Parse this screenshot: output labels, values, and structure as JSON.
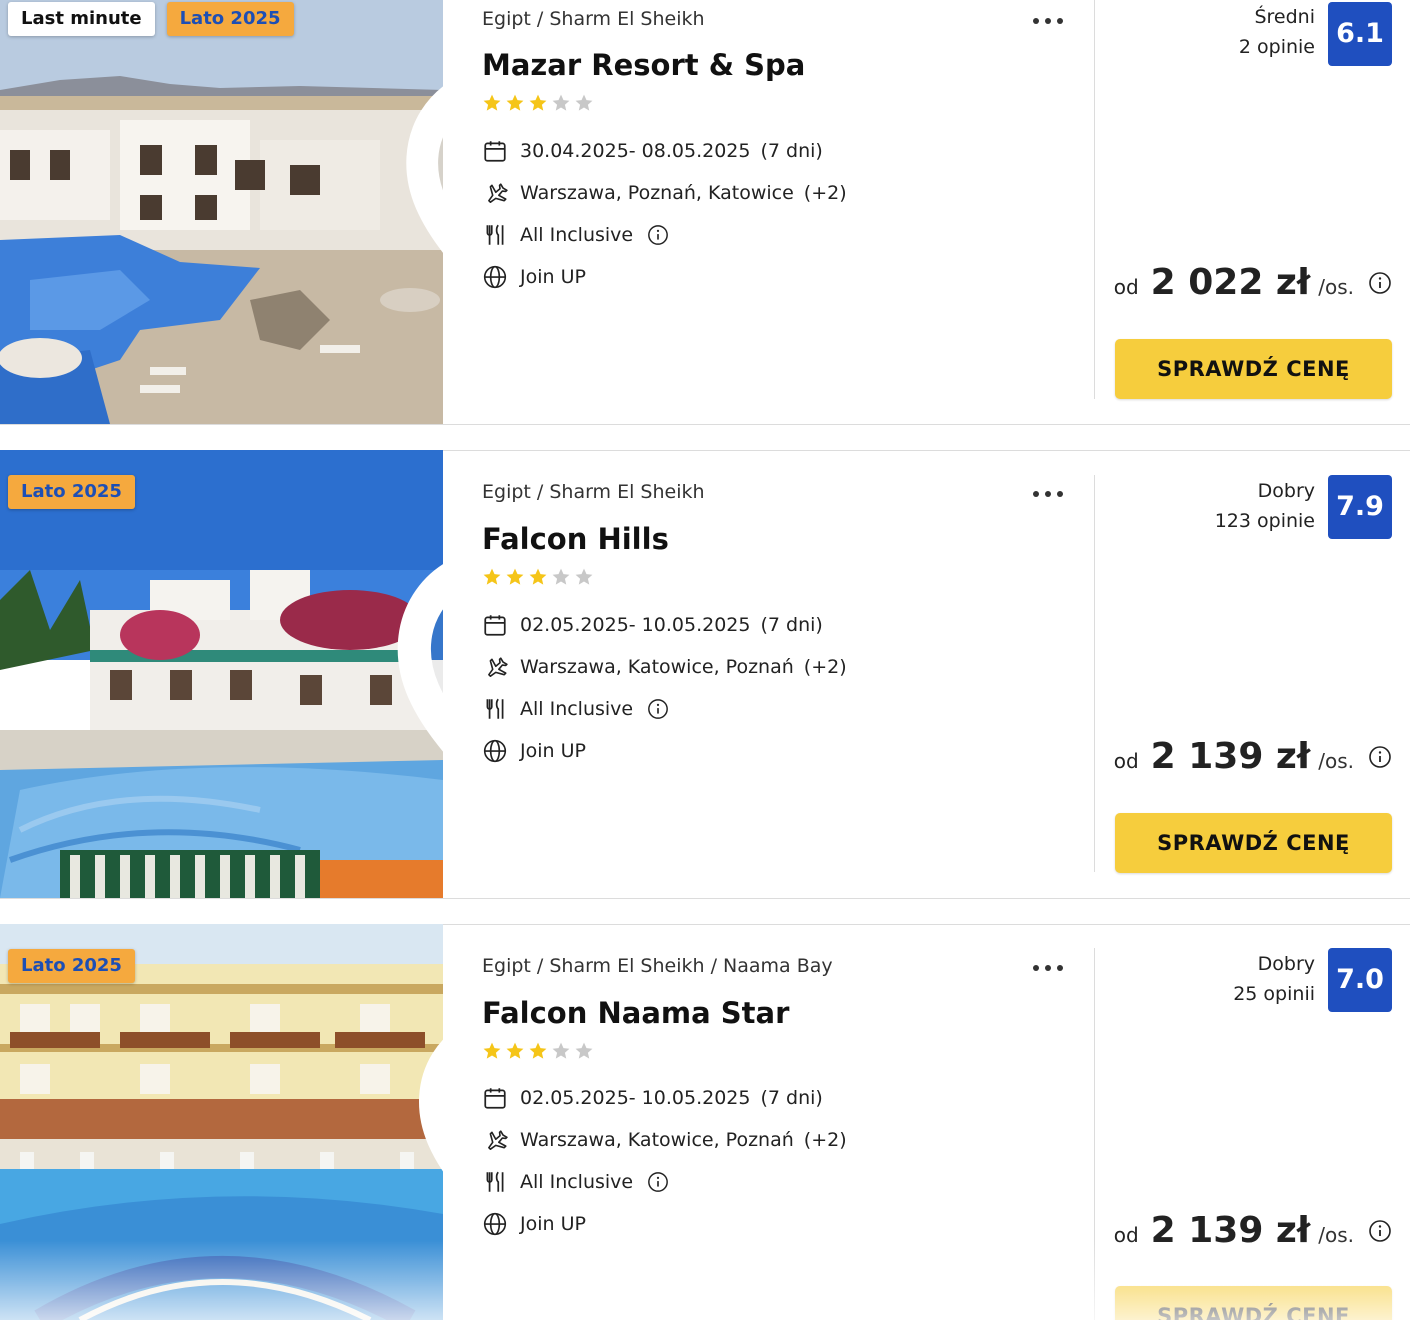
{
  "offers": [
    {
      "badges": [
        "Last minute",
        "Lato 2025"
      ],
      "breadcrumb": "Egipt / Sharm El Sheikh",
      "name": "Mazar Resort & Spa",
      "stars": 3,
      "stars_max": 5,
      "dates": "30.04.2025- 08.05.2025",
      "duration": "(7 dni)",
      "departures": "Warszawa, Poznań, Katowice",
      "departures_more": "(+2)",
      "board": "All Inclusive",
      "operator": "Join UP",
      "rating_label": "Średni",
      "reviews": "2 opinie",
      "score": "6.1",
      "price_prefix": "od",
      "price": "2 022 zł",
      "price_suffix": "/os.",
      "cta": "SPRAWDŹ CENĘ"
    },
    {
      "badges": [
        "Lato 2025"
      ],
      "breadcrumb": "Egipt / Sharm El Sheikh",
      "name": "Falcon Hills",
      "stars": 3,
      "stars_max": 5,
      "dates": "02.05.2025- 10.05.2025",
      "duration": "(7 dni)",
      "departures": "Warszawa, Katowice, Poznań",
      "departures_more": "(+2)",
      "board": "All Inclusive",
      "operator": "Join UP",
      "rating_label": "Dobry",
      "reviews": "123 opinie",
      "score": "7.9",
      "price_prefix": "od",
      "price": "2 139 zł",
      "price_suffix": "/os.",
      "cta": "SPRAWDŹ CENĘ"
    },
    {
      "badges": [
        "Lato 2025"
      ],
      "breadcrumb": "Egipt / Sharm El Sheikh / Naama Bay",
      "name": "Falcon Naama Star",
      "stars": 3,
      "stars_max": 5,
      "dates": "02.05.2025- 10.05.2025",
      "duration": "(7 dni)",
      "departures": "Warszawa, Katowice, Poznań",
      "departures_more": "(+2)",
      "board": "All Inclusive",
      "operator": "Join UP",
      "rating_label": "Dobry",
      "reviews": "25 opinii",
      "score": "7.0",
      "price_prefix": "od",
      "price": "2 139 zł",
      "price_suffix": "/os.",
      "cta": "SPRAWDŹ CENĘ"
    }
  ],
  "colors": {
    "score_bg": "#1f4fbf",
    "cta_bg": "#f6cd3d",
    "badge_orange": "#f5a93e",
    "star_on": "#f5c518",
    "star_off": "#c8c8c8"
  },
  "icons": {
    "favorite": "heart-icon",
    "more": "more-dots-icon",
    "dates": "calendar-icon",
    "departures": "plane-icon",
    "board": "cutlery-icon",
    "operator": "globe-icon",
    "info": "info-icon",
    "rating": "star-icon"
  }
}
